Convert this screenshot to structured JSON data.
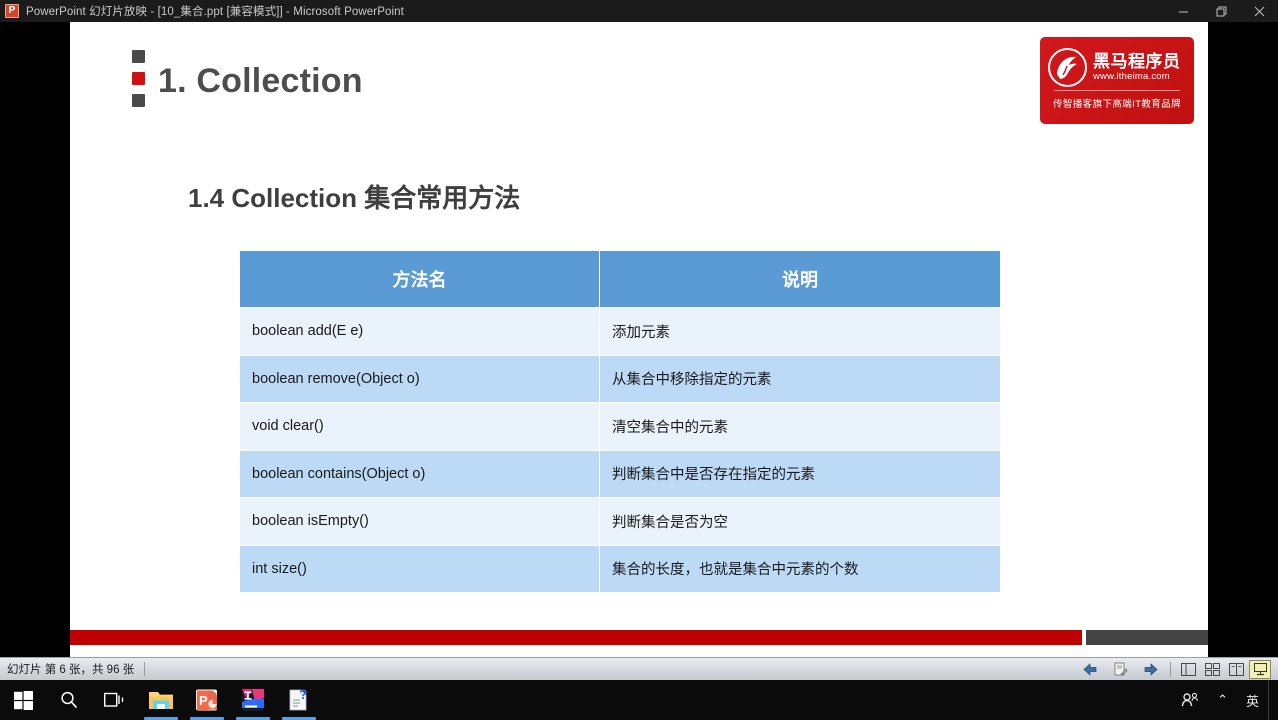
{
  "window": {
    "app_icon": "powerpoint-icon",
    "title": "PowerPoint 幻灯片放映 - [10_集合.ppt [兼容模式]] - Microsoft PowerPoint",
    "controls": {
      "minimize": "minimize-icon",
      "restore": "restore-icon",
      "close": "close-icon"
    }
  },
  "slide": {
    "title": "1. Collection",
    "section_heading": "1.4 Collection 集合常用方法",
    "logo": {
      "mark": "horse-head-icon",
      "brand_cn": "黑马程序员",
      "url": "www.itheima.com",
      "tagline": "传智播客旗下高端IT教育品牌"
    },
    "table": {
      "headers": [
        "方法名",
        "说明"
      ],
      "rows": [
        [
          "boolean add(E e)",
          "添加元素"
        ],
        [
          "boolean remove(Object o)",
          "从集合中移除指定的元素"
        ],
        [
          "void clear()",
          "清空集合中的元素"
        ],
        [
          "boolean contains(Object o)",
          "判断集合中是否存在指定的元素"
        ],
        [
          "boolean isEmpty()",
          "判断集合是否为空"
        ],
        [
          "int size()",
          "集合的长度，也就是集合中元素的个数"
        ]
      ]
    },
    "colors": {
      "header_blue": "#5b9bd5",
      "row_light": "#eaf2fb",
      "row_dark": "#bcd9f6",
      "accent_red": "#c00000",
      "logo_red": "#d0141b",
      "title_gray": "#4d4d4d"
    }
  },
  "statusbar": {
    "slide_counter": "幻灯片 第 6 张，共 96 张",
    "buttons": [
      {
        "name": "previous-slide-button",
        "icon": "arrow-left-icon"
      },
      {
        "name": "pointer-options-button",
        "icon": "pen-icon"
      },
      {
        "name": "next-slide-button",
        "icon": "arrow-right-icon"
      }
    ],
    "view_buttons": [
      {
        "name": "normal-view-button",
        "icon": "normal-view-icon",
        "active": false
      },
      {
        "name": "slide-sorter-button",
        "icon": "slide-sorter-icon",
        "active": false
      },
      {
        "name": "reading-view-button",
        "icon": "reading-view-icon",
        "active": false
      },
      {
        "name": "slide-show-button",
        "icon": "slide-show-icon",
        "active": true
      }
    ]
  },
  "taskbar": {
    "items": [
      {
        "name": "start-button",
        "icon": "windows-logo-icon",
        "running": false
      },
      {
        "name": "search-button",
        "icon": "search-icon",
        "running": false
      },
      {
        "name": "task-view-button",
        "icon": "task-view-icon",
        "running": false
      },
      {
        "name": "file-explorer-button",
        "icon": "folder-icon",
        "running": true
      },
      {
        "name": "powerpoint-button",
        "icon": "powerpoint-icon",
        "running": true
      },
      {
        "name": "intellij-idea-button",
        "icon": "intellij-idea-icon",
        "running": true
      },
      {
        "name": "help-document-button",
        "icon": "help-document-icon",
        "running": true
      }
    ],
    "tray": [
      {
        "name": "people-button",
        "icon": "people-icon",
        "label": ""
      },
      {
        "name": "show-hidden-icons-button",
        "icon": "chevron-up-icon",
        "label": "⌃"
      },
      {
        "name": "ime-indicator",
        "icon": "ime-icon",
        "label": "英"
      }
    ]
  }
}
